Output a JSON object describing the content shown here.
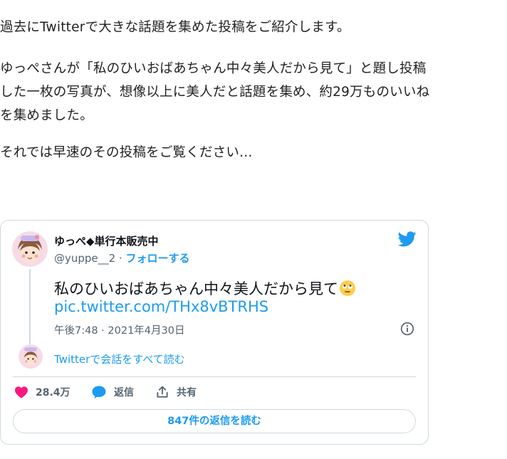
{
  "article": {
    "para1": "過去にTwitterで大きな話題を集めた投稿をご紹介します。",
    "para2_line1": "ゆっぺさんが「私のひいおばあちゃん中々美人だから見て」と題し投稿",
    "para2_line2": "した一枚の写真が、想像以上に美人だと話題を集め、約29万ものいいね",
    "para2_line3": "を集めました。",
    "para3": "それでは早速のその投稿をご覧ください…"
  },
  "tweet": {
    "display_name": "ゆっぺ◆単行本販売中",
    "handle": "@yuppe__2",
    "separator": " · ",
    "follow_label": "フォローする",
    "text": "私のひいおばあちゃん中々美人だから見て",
    "link": "pic.twitter.com/THx8vBTRHS",
    "timestamp": "午後7:48 · 2021年4月30日",
    "thread_link": "Twitterで会話をすべて読む",
    "likes": "28.4万",
    "reply_label": "返信",
    "share_label": "共有",
    "read_replies": "847件の返信を読む"
  },
  "icons": {
    "bird": "twitter-bird-icon",
    "info": "info-icon",
    "heart": "heart-icon",
    "reply": "reply-bubble-icon",
    "share": "share-icon",
    "emoji": "face-with-rolling-eyes-emoji"
  },
  "colors": {
    "twitter_blue": "#1d9bf0",
    "heart": "#f91880",
    "secondary_text": "#536471",
    "border": "#cfd9de"
  }
}
